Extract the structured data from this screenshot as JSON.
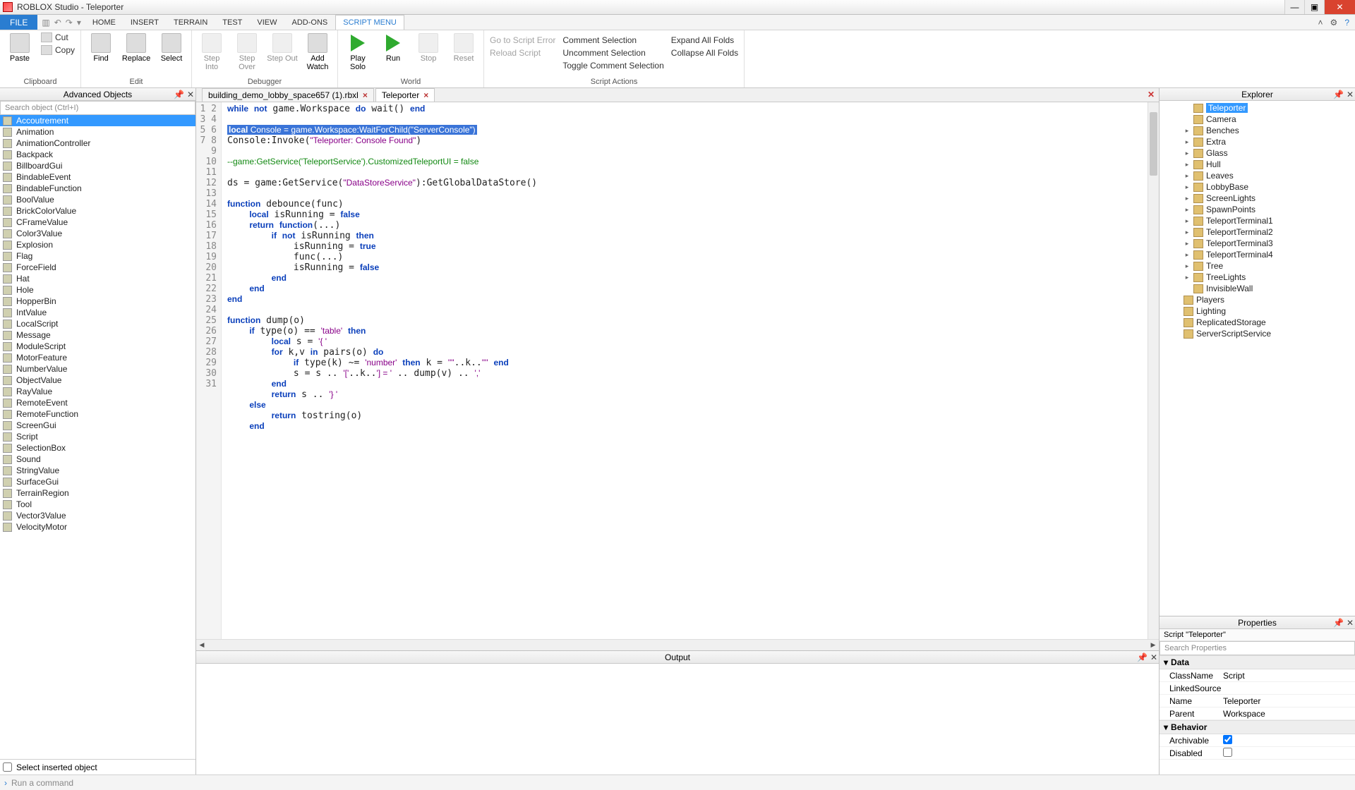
{
  "window": {
    "title": "ROBLOX Studio - Teleporter"
  },
  "menu": {
    "file": "FILE",
    "tabs": [
      "HOME",
      "INSERT",
      "TERRAIN",
      "TEST",
      "VIEW",
      "ADD-ONS",
      "SCRIPT MENU"
    ],
    "active_tab": 6
  },
  "ribbon": {
    "clipboard": {
      "label": "Clipboard",
      "paste": "Paste",
      "cut": "Cut",
      "copy": "Copy"
    },
    "edit": {
      "label": "Edit",
      "find": "Find",
      "replace": "Replace",
      "select": "Select"
    },
    "debugger": {
      "label": "Debugger",
      "step_into": "Step\nInto",
      "step_over": "Step\nOver",
      "step_out": "Step\nOut",
      "add_watch": "Add\nWatch"
    },
    "world": {
      "label": "World",
      "play_solo": "Play\nSolo",
      "run": "Run",
      "stop": "Stop",
      "reset": "Reset"
    },
    "nav": {
      "go_to_error": "Go to Script Error",
      "reload": "Reload Script"
    },
    "script_actions": {
      "label": "Script Actions",
      "comment": "Comment Selection",
      "uncomment": "Uncomment Selection",
      "toggle": "Toggle Comment Selection",
      "expand": "Expand All Folds",
      "collapse": "Collapse All Folds"
    }
  },
  "adv_objects": {
    "title": "Advanced Objects",
    "search_placeholder": "Search object (Ctrl+I)",
    "items": [
      "Accoutrement",
      "Animation",
      "AnimationController",
      "Backpack",
      "BillboardGui",
      "BindableEvent",
      "BindableFunction",
      "BoolValue",
      "BrickColorValue",
      "CFrameValue",
      "Color3Value",
      "Explosion",
      "Flag",
      "ForceField",
      "Hat",
      "Hole",
      "HopperBin",
      "IntValue",
      "LocalScript",
      "Message",
      "ModuleScript",
      "MotorFeature",
      "NumberValue",
      "ObjectValue",
      "RayValue",
      "RemoteEvent",
      "RemoteFunction",
      "ScreenGui",
      "Script",
      "SelectionBox",
      "Sound",
      "StringValue",
      "SurfaceGui",
      "TerrainRegion",
      "Tool",
      "Vector3Value",
      "VelocityMotor"
    ],
    "selected": 0,
    "checkbox_label": "Select inserted object"
  },
  "doc_tabs": {
    "tabs": [
      {
        "label": "building_demo_lobby_space657 (1).rbxl",
        "active": false
      },
      {
        "label": "Teleporter",
        "active": true
      }
    ]
  },
  "code": {
    "lines": [
      {
        "n": 1,
        "html": "<span class='kw'>while</span> <span class='kw'>not</span> game.Workspace <span class='kw'>do</span> wait() <span class='kw'>end</span>"
      },
      {
        "n": 2,
        "html": ""
      },
      {
        "n": 3,
        "html": "<span class='sel-line'><span class='kw'>local</span> Console = game.Workspace:WaitForChild(<span class='str'>\"ServerConsole\"</span>)</span>"
      },
      {
        "n": 4,
        "html": "Console:Invoke(<span class='str'>\"Teleporter: Console Found\"</span>)"
      },
      {
        "n": 5,
        "html": ""
      },
      {
        "n": 6,
        "html": "<span class='cm'>--game:GetService('TeleportService').CustomizedTeleportUI = false</span>"
      },
      {
        "n": 7,
        "html": ""
      },
      {
        "n": 8,
        "html": "ds = game:GetService(<span class='str'>\"DataStoreService\"</span>):GetGlobalDataStore()"
      },
      {
        "n": 9,
        "html": ""
      },
      {
        "n": 10,
        "html": "<span class='kw'>function</span> debounce(func)"
      },
      {
        "n": 11,
        "html": "    <span class='kw'>local</span> isRunning = <span class='kw'>false</span>"
      },
      {
        "n": 12,
        "html": "    <span class='kw'>return</span> <span class='kw'>function</span>(...)"
      },
      {
        "n": 13,
        "html": "        <span class='kw'>if</span> <span class='kw'>not</span> isRunning <span class='kw'>then</span>"
      },
      {
        "n": 14,
        "html": "            isRunning = <span class='kw'>true</span>"
      },
      {
        "n": 15,
        "html": "            func(...)"
      },
      {
        "n": 16,
        "html": "            isRunning = <span class='kw'>false</span>"
      },
      {
        "n": 17,
        "html": "        <span class='kw'>end</span>"
      },
      {
        "n": 18,
        "html": "    <span class='kw'>end</span>"
      },
      {
        "n": 19,
        "html": "<span class='kw'>end</span>"
      },
      {
        "n": 20,
        "html": ""
      },
      {
        "n": 21,
        "html": "<span class='kw'>function</span> dump(o)"
      },
      {
        "n": 22,
        "html": "    <span class='kw'>if</span> type(o) == <span class='str'>'table'</span> <span class='kw'>then</span>"
      },
      {
        "n": 23,
        "html": "        <span class='kw'>local</span> s = <span class='str'>'{ '</span>"
      },
      {
        "n": 24,
        "html": "        <span class='kw'>for</span> k,v <span class='kw'>in</span> pairs(o) <span class='kw'>do</span>"
      },
      {
        "n": 25,
        "html": "            <span class='kw'>if</span> type(k) ~= <span class='str'>'number'</span> <span class='kw'>then</span> k = <span class='str'>'\"'</span>..k..<span class='str'>'\"'</span> <span class='kw'>end</span>"
      },
      {
        "n": 26,
        "html": "            s = s .. <span class='str'>'['</span>..k..<span class='str'>'] = '</span> .. dump(v) .. <span class='str'>','</span>"
      },
      {
        "n": 27,
        "html": "        <span class='kw'>end</span>"
      },
      {
        "n": 28,
        "html": "        <span class='kw'>return</span> s .. <span class='str'>'} '</span>"
      },
      {
        "n": 29,
        "html": "    <span class='kw'>else</span>"
      },
      {
        "n": 30,
        "html": "        <span class='kw'>return</span> tostring(o)"
      },
      {
        "n": 31,
        "html": "    <span class='kw'>end</span>"
      }
    ]
  },
  "output": {
    "title": "Output"
  },
  "explorer": {
    "title": "Explorer",
    "selected": "Teleporter",
    "nodes": [
      {
        "indent": 2,
        "exp": "",
        "icon": "script",
        "label": "Teleporter",
        "sel": true
      },
      {
        "indent": 2,
        "exp": "",
        "icon": "cam",
        "label": "Camera"
      },
      {
        "indent": 2,
        "exp": "▸",
        "icon": "model",
        "label": "Benches"
      },
      {
        "indent": 2,
        "exp": "▸",
        "icon": "model",
        "label": "Extra"
      },
      {
        "indent": 2,
        "exp": "▸",
        "icon": "model",
        "label": "Glass"
      },
      {
        "indent": 2,
        "exp": "▸",
        "icon": "model",
        "label": "Hull"
      },
      {
        "indent": 2,
        "exp": "▸",
        "icon": "model",
        "label": "Leaves"
      },
      {
        "indent": 2,
        "exp": "▸",
        "icon": "model",
        "label": "LobbyBase"
      },
      {
        "indent": 2,
        "exp": "▸",
        "icon": "model",
        "label": "ScreenLights"
      },
      {
        "indent": 2,
        "exp": "▸",
        "icon": "model",
        "label": "SpawnPoints"
      },
      {
        "indent": 2,
        "exp": "▸",
        "icon": "model",
        "label": "TeleportTerminal1"
      },
      {
        "indent": 2,
        "exp": "▸",
        "icon": "model",
        "label": "TeleportTerminal2"
      },
      {
        "indent": 2,
        "exp": "▸",
        "icon": "model",
        "label": "TeleportTerminal3"
      },
      {
        "indent": 2,
        "exp": "▸",
        "icon": "model",
        "label": "TeleportTerminal4"
      },
      {
        "indent": 2,
        "exp": "▸",
        "icon": "model",
        "label": "Tree"
      },
      {
        "indent": 2,
        "exp": "▸",
        "icon": "model",
        "label": "TreeLights"
      },
      {
        "indent": 2,
        "exp": "",
        "icon": "part",
        "label": "InvisibleWall"
      },
      {
        "indent": 1,
        "exp": "",
        "icon": "players",
        "label": "Players"
      },
      {
        "indent": 1,
        "exp": "",
        "icon": "light",
        "label": "Lighting"
      },
      {
        "indent": 1,
        "exp": "",
        "icon": "storage",
        "label": "ReplicatedStorage"
      },
      {
        "indent": 1,
        "exp": "",
        "icon": "svc",
        "label": "ServerScriptService"
      }
    ]
  },
  "properties": {
    "title": "Properties",
    "subtitle": "Script \"Teleporter\"",
    "search_placeholder": "Search Properties",
    "sections": [
      {
        "title": "Data",
        "rows": [
          {
            "k": "ClassName",
            "v": "Script"
          },
          {
            "k": "LinkedSource",
            "v": ""
          },
          {
            "k": "Name",
            "v": "Teleporter"
          },
          {
            "k": "Parent",
            "v": "Workspace"
          }
        ]
      },
      {
        "title": "Behavior",
        "rows": [
          {
            "k": "Archivable",
            "v": "",
            "check": true,
            "checked": true
          },
          {
            "k": "Disabled",
            "v": "",
            "check": true,
            "checked": false
          }
        ]
      }
    ]
  },
  "statusbar": {
    "command_placeholder": "Run a command"
  }
}
